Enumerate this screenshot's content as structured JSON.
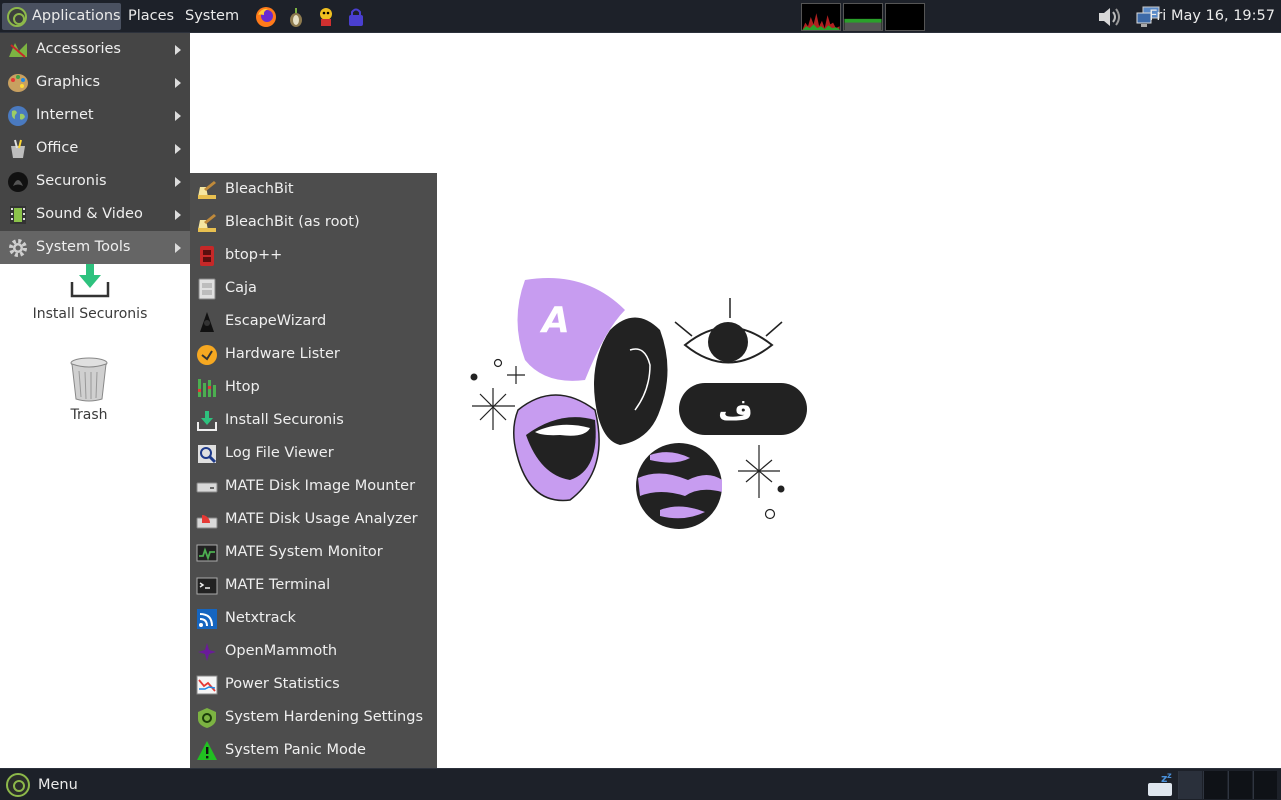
{
  "top_panel": {
    "applications": "Applications",
    "places": "Places",
    "system": "System",
    "clock": "Fri May 16, 19:57"
  },
  "apps_menu": {
    "items": [
      {
        "label": "Accessories"
      },
      {
        "label": "Graphics"
      },
      {
        "label": "Internet"
      },
      {
        "label": "Office"
      },
      {
        "label": "Securonis"
      },
      {
        "label": "Sound & Video"
      },
      {
        "label": "System Tools"
      }
    ]
  },
  "submenu": {
    "items": [
      {
        "label": "BleachBit"
      },
      {
        "label": "BleachBit (as root)"
      },
      {
        "label": "btop++"
      },
      {
        "label": "Caja"
      },
      {
        "label": "EscapeWizard"
      },
      {
        "label": "Hardware Lister"
      },
      {
        "label": "Htop"
      },
      {
        "label": "Install Securonis"
      },
      {
        "label": "Log File Viewer"
      },
      {
        "label": "MATE Disk Image Mounter"
      },
      {
        "label": "MATE Disk Usage Analyzer"
      },
      {
        "label": "MATE System Monitor"
      },
      {
        "label": "MATE Terminal"
      },
      {
        "label": "Netxtrack"
      },
      {
        "label": "OpenMammoth"
      },
      {
        "label": "Power Statistics"
      },
      {
        "label": "System Hardening Settings"
      },
      {
        "label": "System Panic Mode"
      }
    ]
  },
  "desktop": {
    "install_label": "Install Securonis",
    "trash_label": "Trash",
    "wallpaper_letter": "A",
    "wallpaper_arabic": "ف"
  },
  "bottom_panel": {
    "menu_label": "Menu"
  },
  "colors": {
    "panel_bg": "#1d2129",
    "menu_bg": "#454545",
    "submenu_bg": "#4d4d4d",
    "accent_green": "#8db84a",
    "wallpaper_purple": "#c79cf0"
  }
}
